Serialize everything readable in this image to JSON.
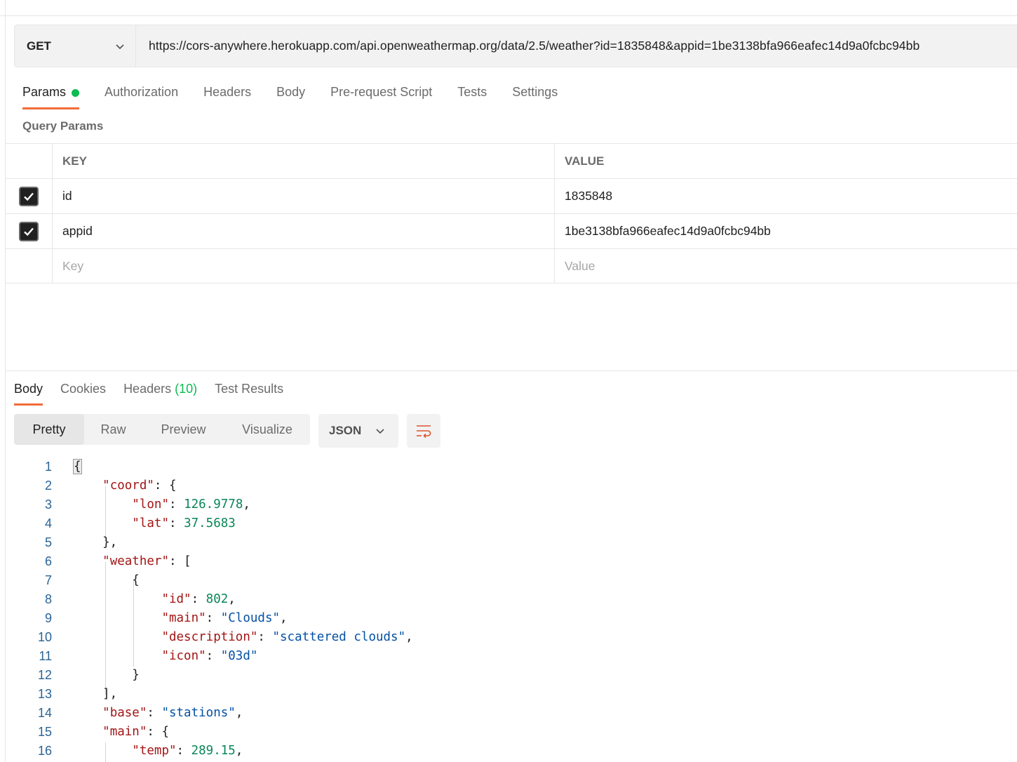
{
  "request": {
    "method": "GET",
    "url": "https://cors-anywhere.herokuapp.com/api.openweathermap.org/data/2.5/weather?id=1835848&appid=1be3138bfa966eafec14d9a0fcbc94bb"
  },
  "request_tabs": [
    "Params",
    "Authorization",
    "Headers",
    "Body",
    "Pre-request Script",
    "Tests",
    "Settings"
  ],
  "query_params": {
    "title": "Query Params",
    "key_header": "KEY",
    "value_header": "VALUE",
    "rows": [
      {
        "key": "id",
        "value": "1835848",
        "checked": true
      },
      {
        "key": "appid",
        "value": "1be3138bfa966eafec14d9a0fcbc94bb",
        "checked": true
      }
    ],
    "key_placeholder": "Key",
    "value_placeholder": "Value"
  },
  "response_tabs": {
    "body": "Body",
    "cookies": "Cookies",
    "headers": "Headers",
    "headers_count": "(10)",
    "test_results": "Test Results"
  },
  "format_modes": [
    "Pretty",
    "Raw",
    "Preview",
    "Visualize"
  ],
  "language": "JSON",
  "code_lines": [
    "1",
    "2",
    "3",
    "4",
    "5",
    "6",
    "7",
    "8",
    "9",
    "10",
    "11",
    "12",
    "13",
    "14",
    "15",
    "16"
  ],
  "json_body": {
    "lon": "126.9778",
    "lat": "37.5683",
    "weather_id": "802",
    "main": "\"Clouds\"",
    "description": "\"scattered clouds\"",
    "icon": "\"03d\"",
    "base": "\"stations\"",
    "temp": "289.15"
  },
  "colors": {
    "accent": "#f26b3a",
    "status_green": "#0cbb52"
  }
}
